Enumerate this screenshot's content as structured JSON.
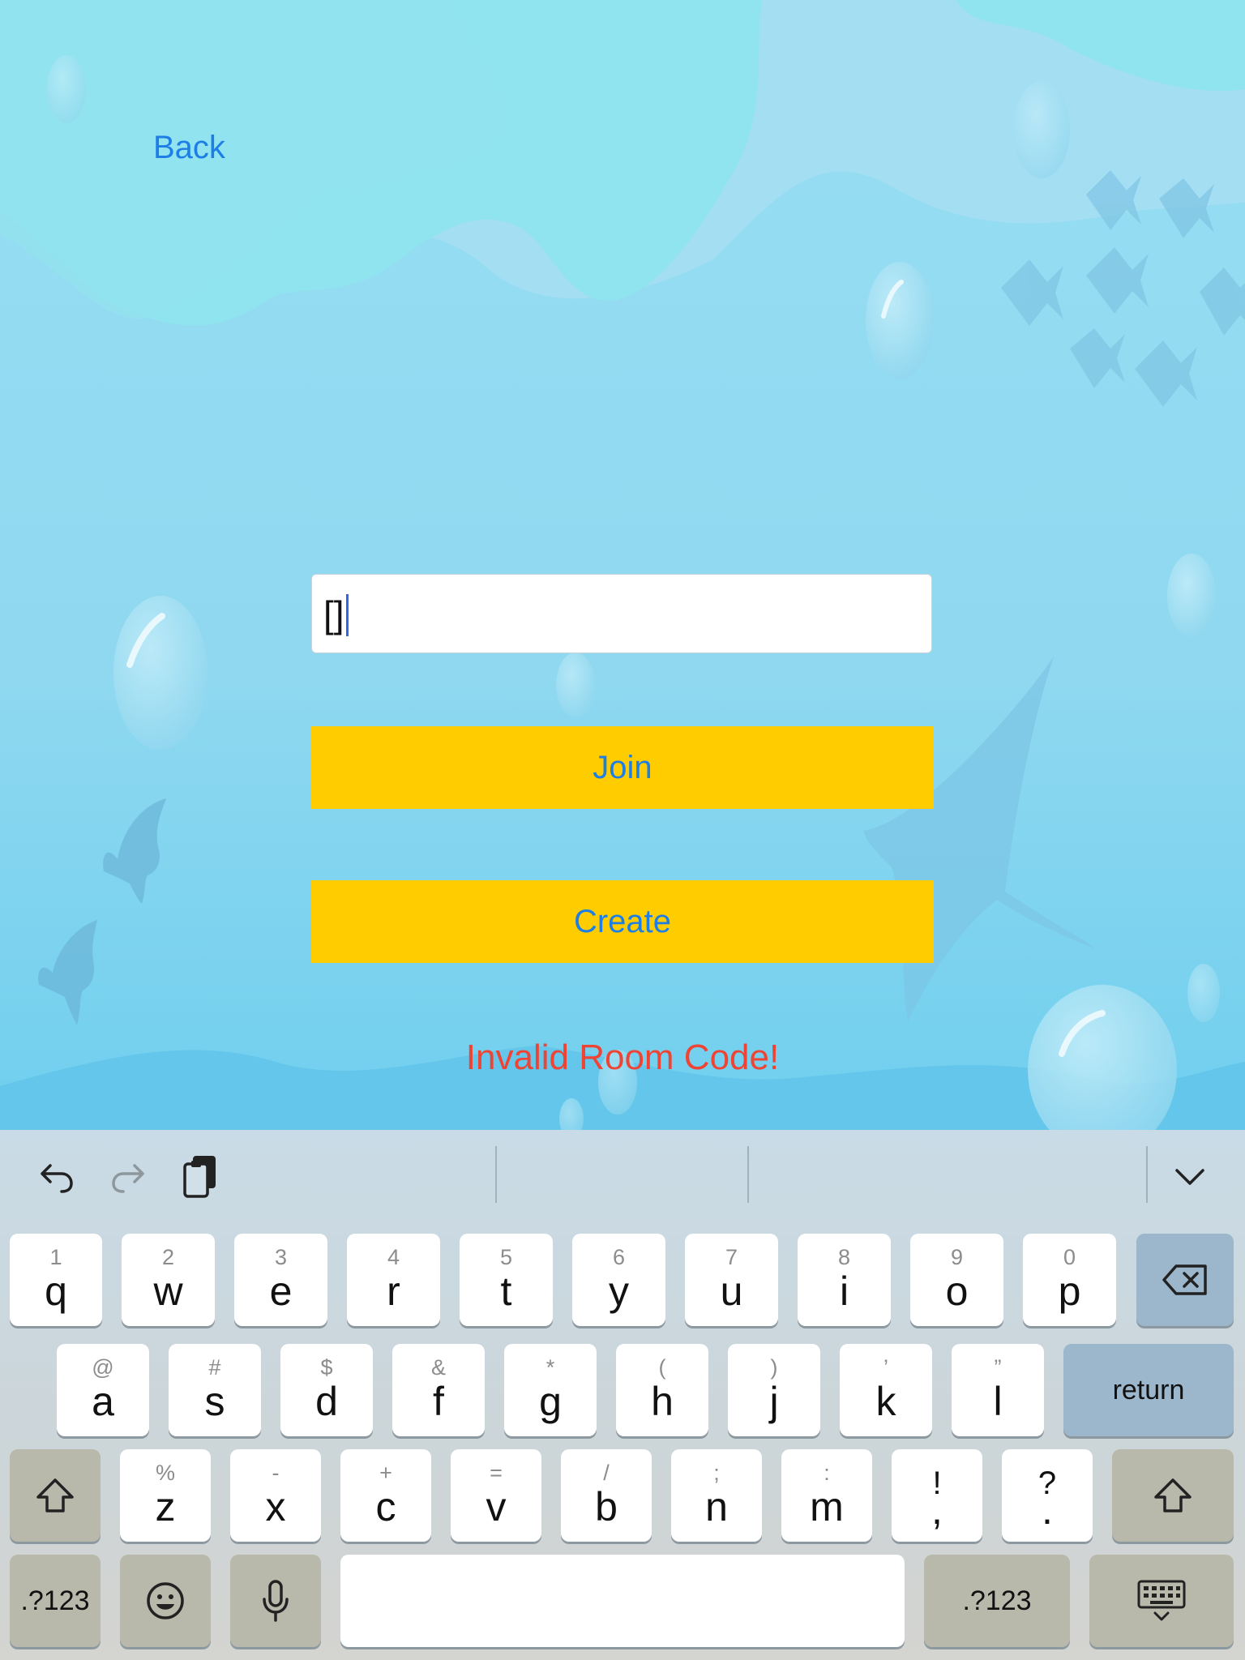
{
  "screen": {
    "back_label": "Back",
    "room_code_value": "[]",
    "join_label": "Join",
    "create_label": "Create",
    "error_message": "Invalid Room Code!"
  },
  "colors": {
    "accent": "#1d7fe6",
    "button_bg": "#ffcc00",
    "error": "#ef4434",
    "caret": "#2f67e8"
  },
  "keyboard": {
    "toolbar": {
      "undo_icon": "undo-icon",
      "redo_icon": "redo-icon",
      "paste_icon": "clipboard-paste-icon",
      "dismiss_icon": "chevron-down-icon"
    },
    "row1": [
      {
        "hint": "1",
        "key": "q"
      },
      {
        "hint": "2",
        "key": "w"
      },
      {
        "hint": "3",
        "key": "e"
      },
      {
        "hint": "4",
        "key": "r"
      },
      {
        "hint": "5",
        "key": "t"
      },
      {
        "hint": "6",
        "key": "y"
      },
      {
        "hint": "7",
        "key": "u"
      },
      {
        "hint": "8",
        "key": "i"
      },
      {
        "hint": "9",
        "key": "o"
      },
      {
        "hint": "0",
        "key": "p"
      }
    ],
    "row2": [
      {
        "hint": "@",
        "key": "a"
      },
      {
        "hint": "#",
        "key": "s"
      },
      {
        "hint": "$",
        "key": "d"
      },
      {
        "hint": "&",
        "key": "f"
      },
      {
        "hint": "*",
        "key": "g"
      },
      {
        "hint": "(",
        "key": "h"
      },
      {
        "hint": ")",
        "key": "j"
      },
      {
        "hint": "’",
        "key": "k"
      },
      {
        "hint": "”",
        "key": "l"
      }
    ],
    "row3": [
      {
        "hint": "%",
        "key": "z"
      },
      {
        "hint": "-",
        "key": "x"
      },
      {
        "hint": "+",
        "key": "c"
      },
      {
        "hint": "=",
        "key": "v"
      },
      {
        "hint": "/",
        "key": "b"
      },
      {
        "hint": ";",
        "key": "n"
      },
      {
        "hint": ":",
        "key": "m"
      },
      {
        "hint": "!",
        "key": ","
      },
      {
        "hint": "?",
        "key": "."
      }
    ],
    "return_label": "return",
    "numbers_label_left": ".?123",
    "numbers_label_right": ".?123",
    "space_label": ""
  }
}
